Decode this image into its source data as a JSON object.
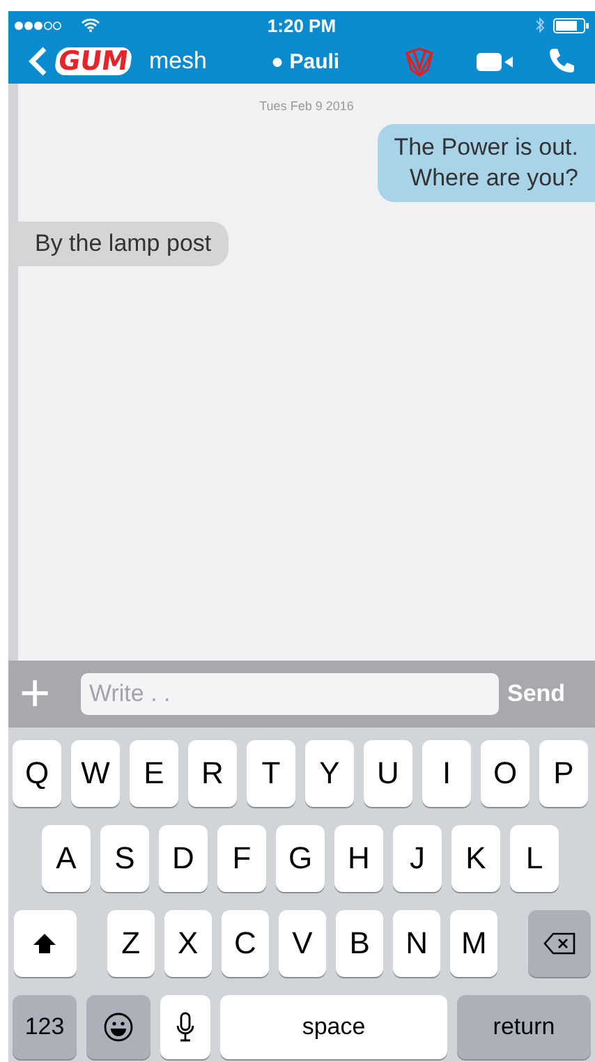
{
  "status_bar": {
    "time": "1:20 PM"
  },
  "nav": {
    "back_logo": "GUM",
    "group": "mesh",
    "contact": "● Pauli"
  },
  "chat": {
    "date": "Tues Feb 9 2016",
    "messages": [
      {
        "text": "The Power is out.\nWhere are you?",
        "kind": "outgoing"
      },
      {
        "text": "By the lamp post",
        "kind": "incoming"
      }
    ]
  },
  "composer": {
    "add": "+",
    "placeholder": "Write . .",
    "send": "Send"
  },
  "keyboard": {
    "rows": [
      {
        "keys": [
          {
            "kind": "letter",
            "label": "Q"
          },
          {
            "kind": "letter",
            "label": "W"
          },
          {
            "kind": "letter",
            "label": "E"
          },
          {
            "kind": "letter",
            "label": "R"
          },
          {
            "kind": "letter",
            "label": "T"
          },
          {
            "kind": "letter",
            "label": "Y"
          },
          {
            "kind": "letter",
            "label": "U"
          },
          {
            "kind": "letter",
            "label": "I"
          },
          {
            "kind": "letter",
            "label": "O"
          },
          {
            "kind": "letter",
            "label": "P"
          }
        ]
      },
      {
        "keys": [
          {
            "kind": "letter",
            "label": "A"
          },
          {
            "kind": "letter",
            "label": "S"
          },
          {
            "kind": "letter",
            "label": "D"
          },
          {
            "kind": "letter",
            "label": "F"
          },
          {
            "kind": "letter",
            "label": "G"
          },
          {
            "kind": "letter",
            "label": "H"
          },
          {
            "kind": "letter",
            "label": "J"
          },
          {
            "kind": "letter",
            "label": "K"
          },
          {
            "kind": "letter",
            "label": "L"
          }
        ]
      },
      {
        "keys": [
          {
            "kind": "shift"
          },
          {
            "kind": "letter",
            "label": "Z"
          },
          {
            "kind": "letter",
            "label": "X"
          },
          {
            "kind": "letter",
            "label": "C"
          },
          {
            "kind": "letter",
            "label": "V"
          },
          {
            "kind": "letter",
            "label": "B"
          },
          {
            "kind": "letter",
            "label": "N"
          },
          {
            "kind": "letter",
            "label": "M"
          },
          {
            "kind": "delete"
          }
        ]
      },
      {
        "keys": [
          {
            "kind": "numbers",
            "label": "123"
          },
          {
            "kind": "emoji"
          },
          {
            "kind": "mic"
          },
          {
            "kind": "space",
            "label": "space"
          },
          {
            "kind": "return",
            "label": "return"
          }
        ]
      }
    ]
  }
}
